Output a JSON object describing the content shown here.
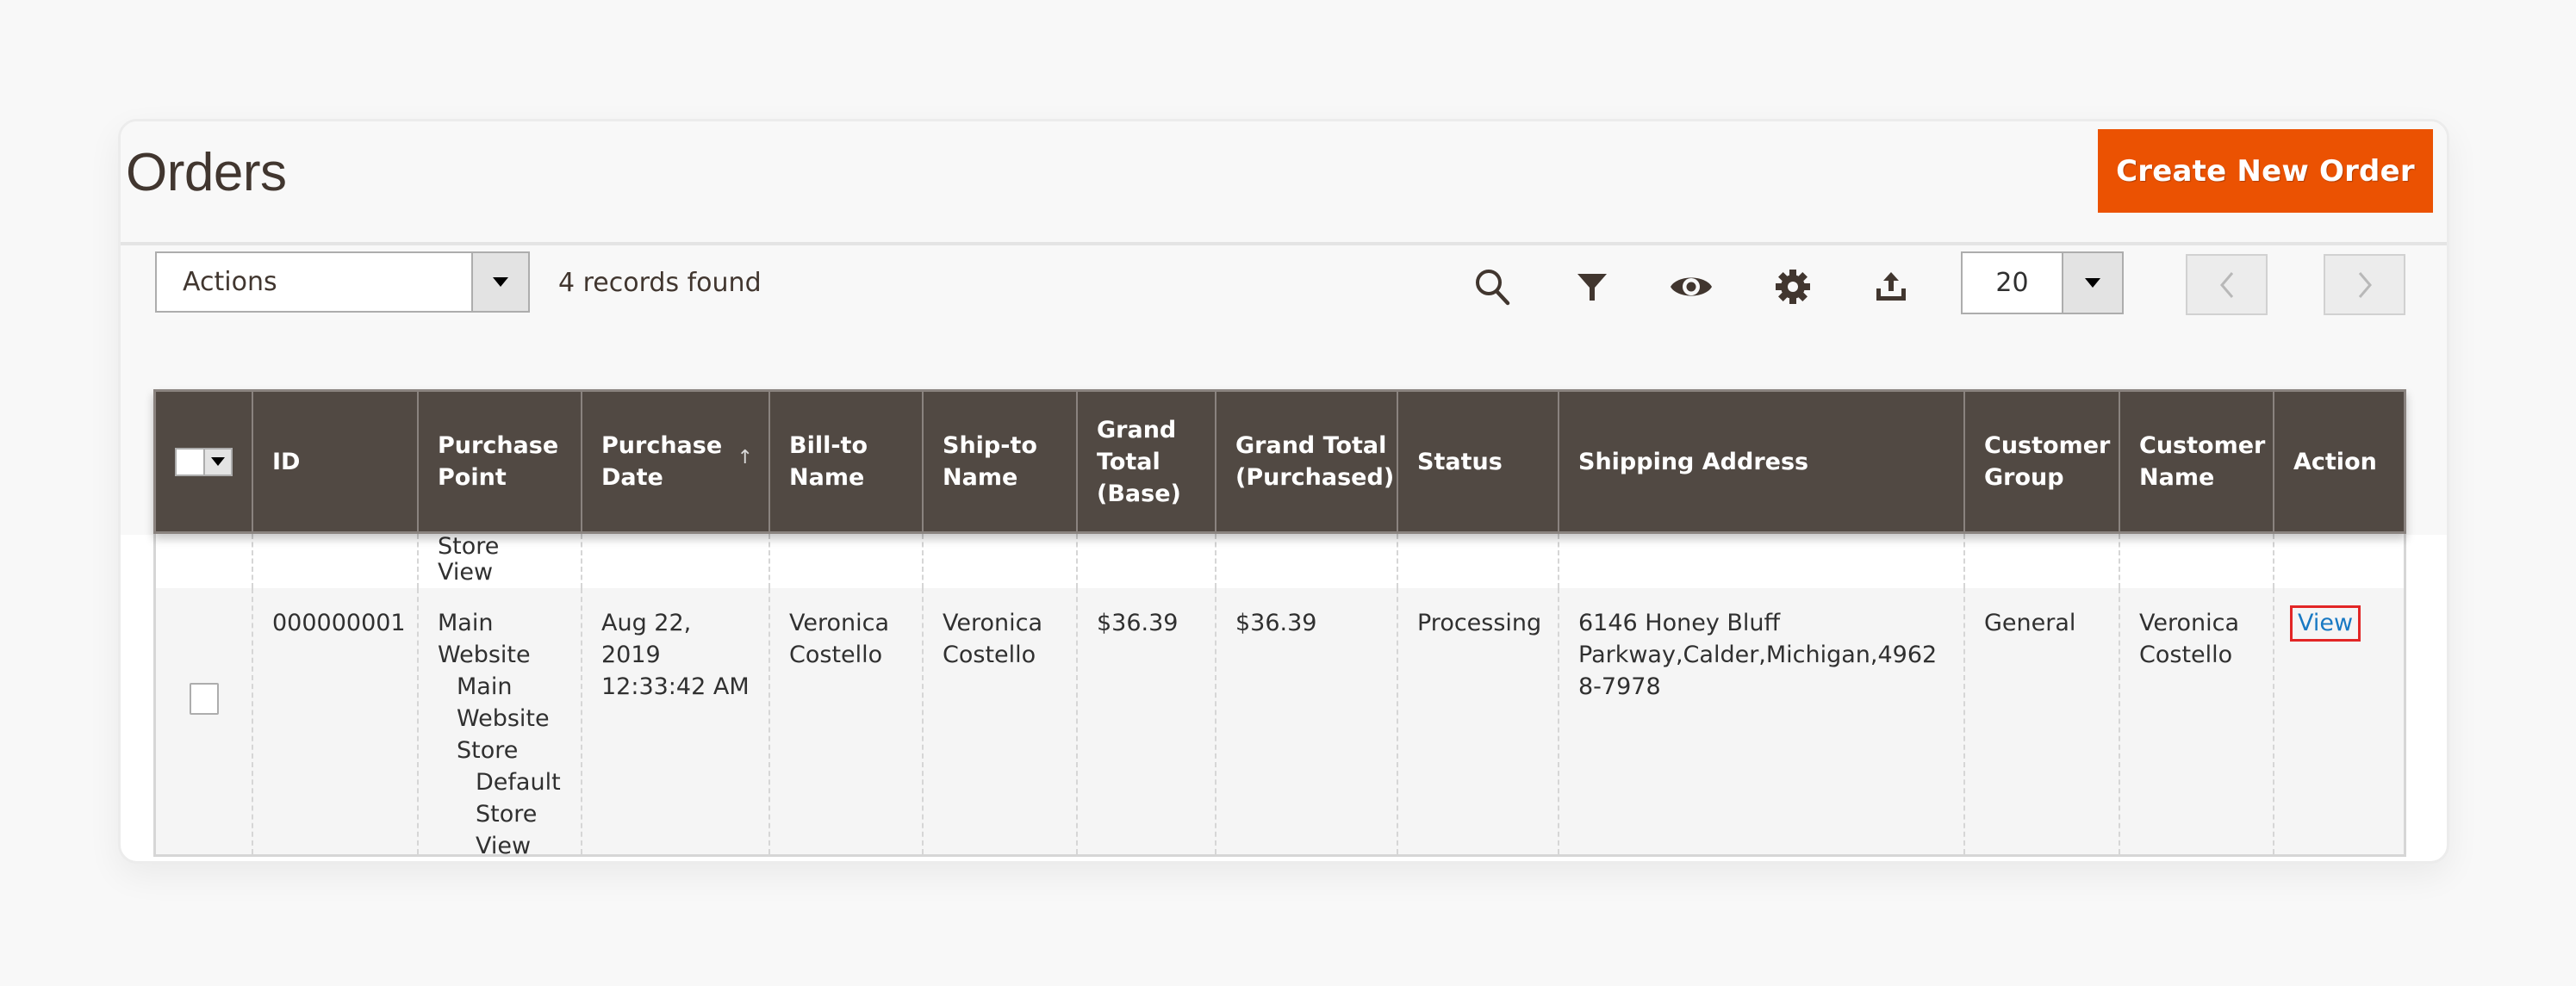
{
  "page": {
    "title": "Orders",
    "create_button": "Create New Order"
  },
  "toolbar": {
    "actions_label": "Actions",
    "records_found": "4 records found",
    "icons": [
      "search-icon",
      "filter-icon",
      "columns-eye-icon",
      "gear-icon",
      "export-icon"
    ],
    "per_page": "20"
  },
  "colors": {
    "accent_button": "#eb5202",
    "header_bg": "#514943",
    "link": "#1979c3",
    "highlight_border": "#e22626"
  },
  "table": {
    "sort": {
      "column": "Purchase Date",
      "direction": "ascending",
      "indicator": "↑"
    },
    "columns": [
      "",
      "ID",
      "Purchase Point",
      "Purchase Date",
      "Bill-to Name",
      "Ship-to Name",
      "Grand Total (Base)",
      "Grand Total (Purchased)",
      "Status",
      "Shipping Address",
      "Customer Group",
      "Customer Name",
      "Action"
    ],
    "partial_row": {
      "purchase_point_tail": "Store View"
    },
    "rows": [
      {
        "id": "000000001",
        "purchase_point": [
          "Main Website",
          "Main Website Store",
          "Default Store View"
        ],
        "purchase_date": "Aug 22, 2019 12:33:42 AM",
        "bill_to_name": "Veronica Costello",
        "ship_to_name": "Veronica Costello",
        "grand_total_base": "$36.39",
        "grand_total_purchased": "$36.39",
        "status": "Processing",
        "shipping_address": "6146 Honey Bluff Parkway,Calder,Michigan,49628-7978",
        "customer_group": "General",
        "customer_name": "Veronica Costello",
        "action": "View"
      }
    ]
  }
}
